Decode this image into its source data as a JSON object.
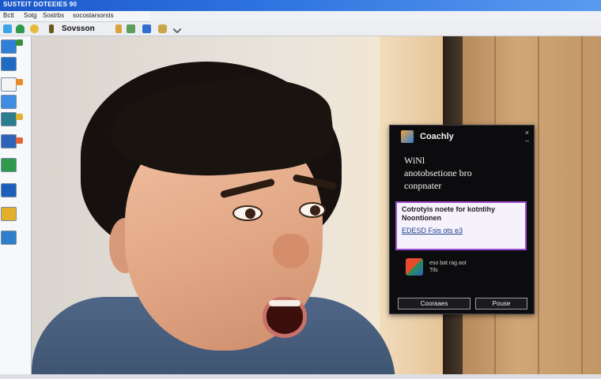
{
  "window": {
    "title": "SUSTEIT DOTEEIES 90"
  },
  "menubar": {
    "items": [
      "Bctt",
      "Sotg",
      "Sostrbs",
      "socostarsorsts"
    ]
  },
  "toolbar": {
    "label": "Sovsson"
  },
  "dialog": {
    "title": "Coachly",
    "close_label": "×",
    "minimize_label": "–",
    "heading_line1": "WiNl",
    "heading_line2": "anotobsetione bro",
    "heading_line3": "conpnater",
    "box_text_line1": "Cotrotyis noete for kotntihy",
    "box_text_line2": "Noontionen",
    "box_field": "EDESD Fsis ots e3",
    "shield_text_line1": "eso bat rag aot",
    "shield_text_line2": "Tils",
    "button_left": "Cooraaes",
    "button_right": "Pouse"
  },
  "colors": {
    "titlebar": "#1b57c9",
    "dialog_bg": "#0c0c0e",
    "dialog_box_border": "#9b4bd0"
  }
}
